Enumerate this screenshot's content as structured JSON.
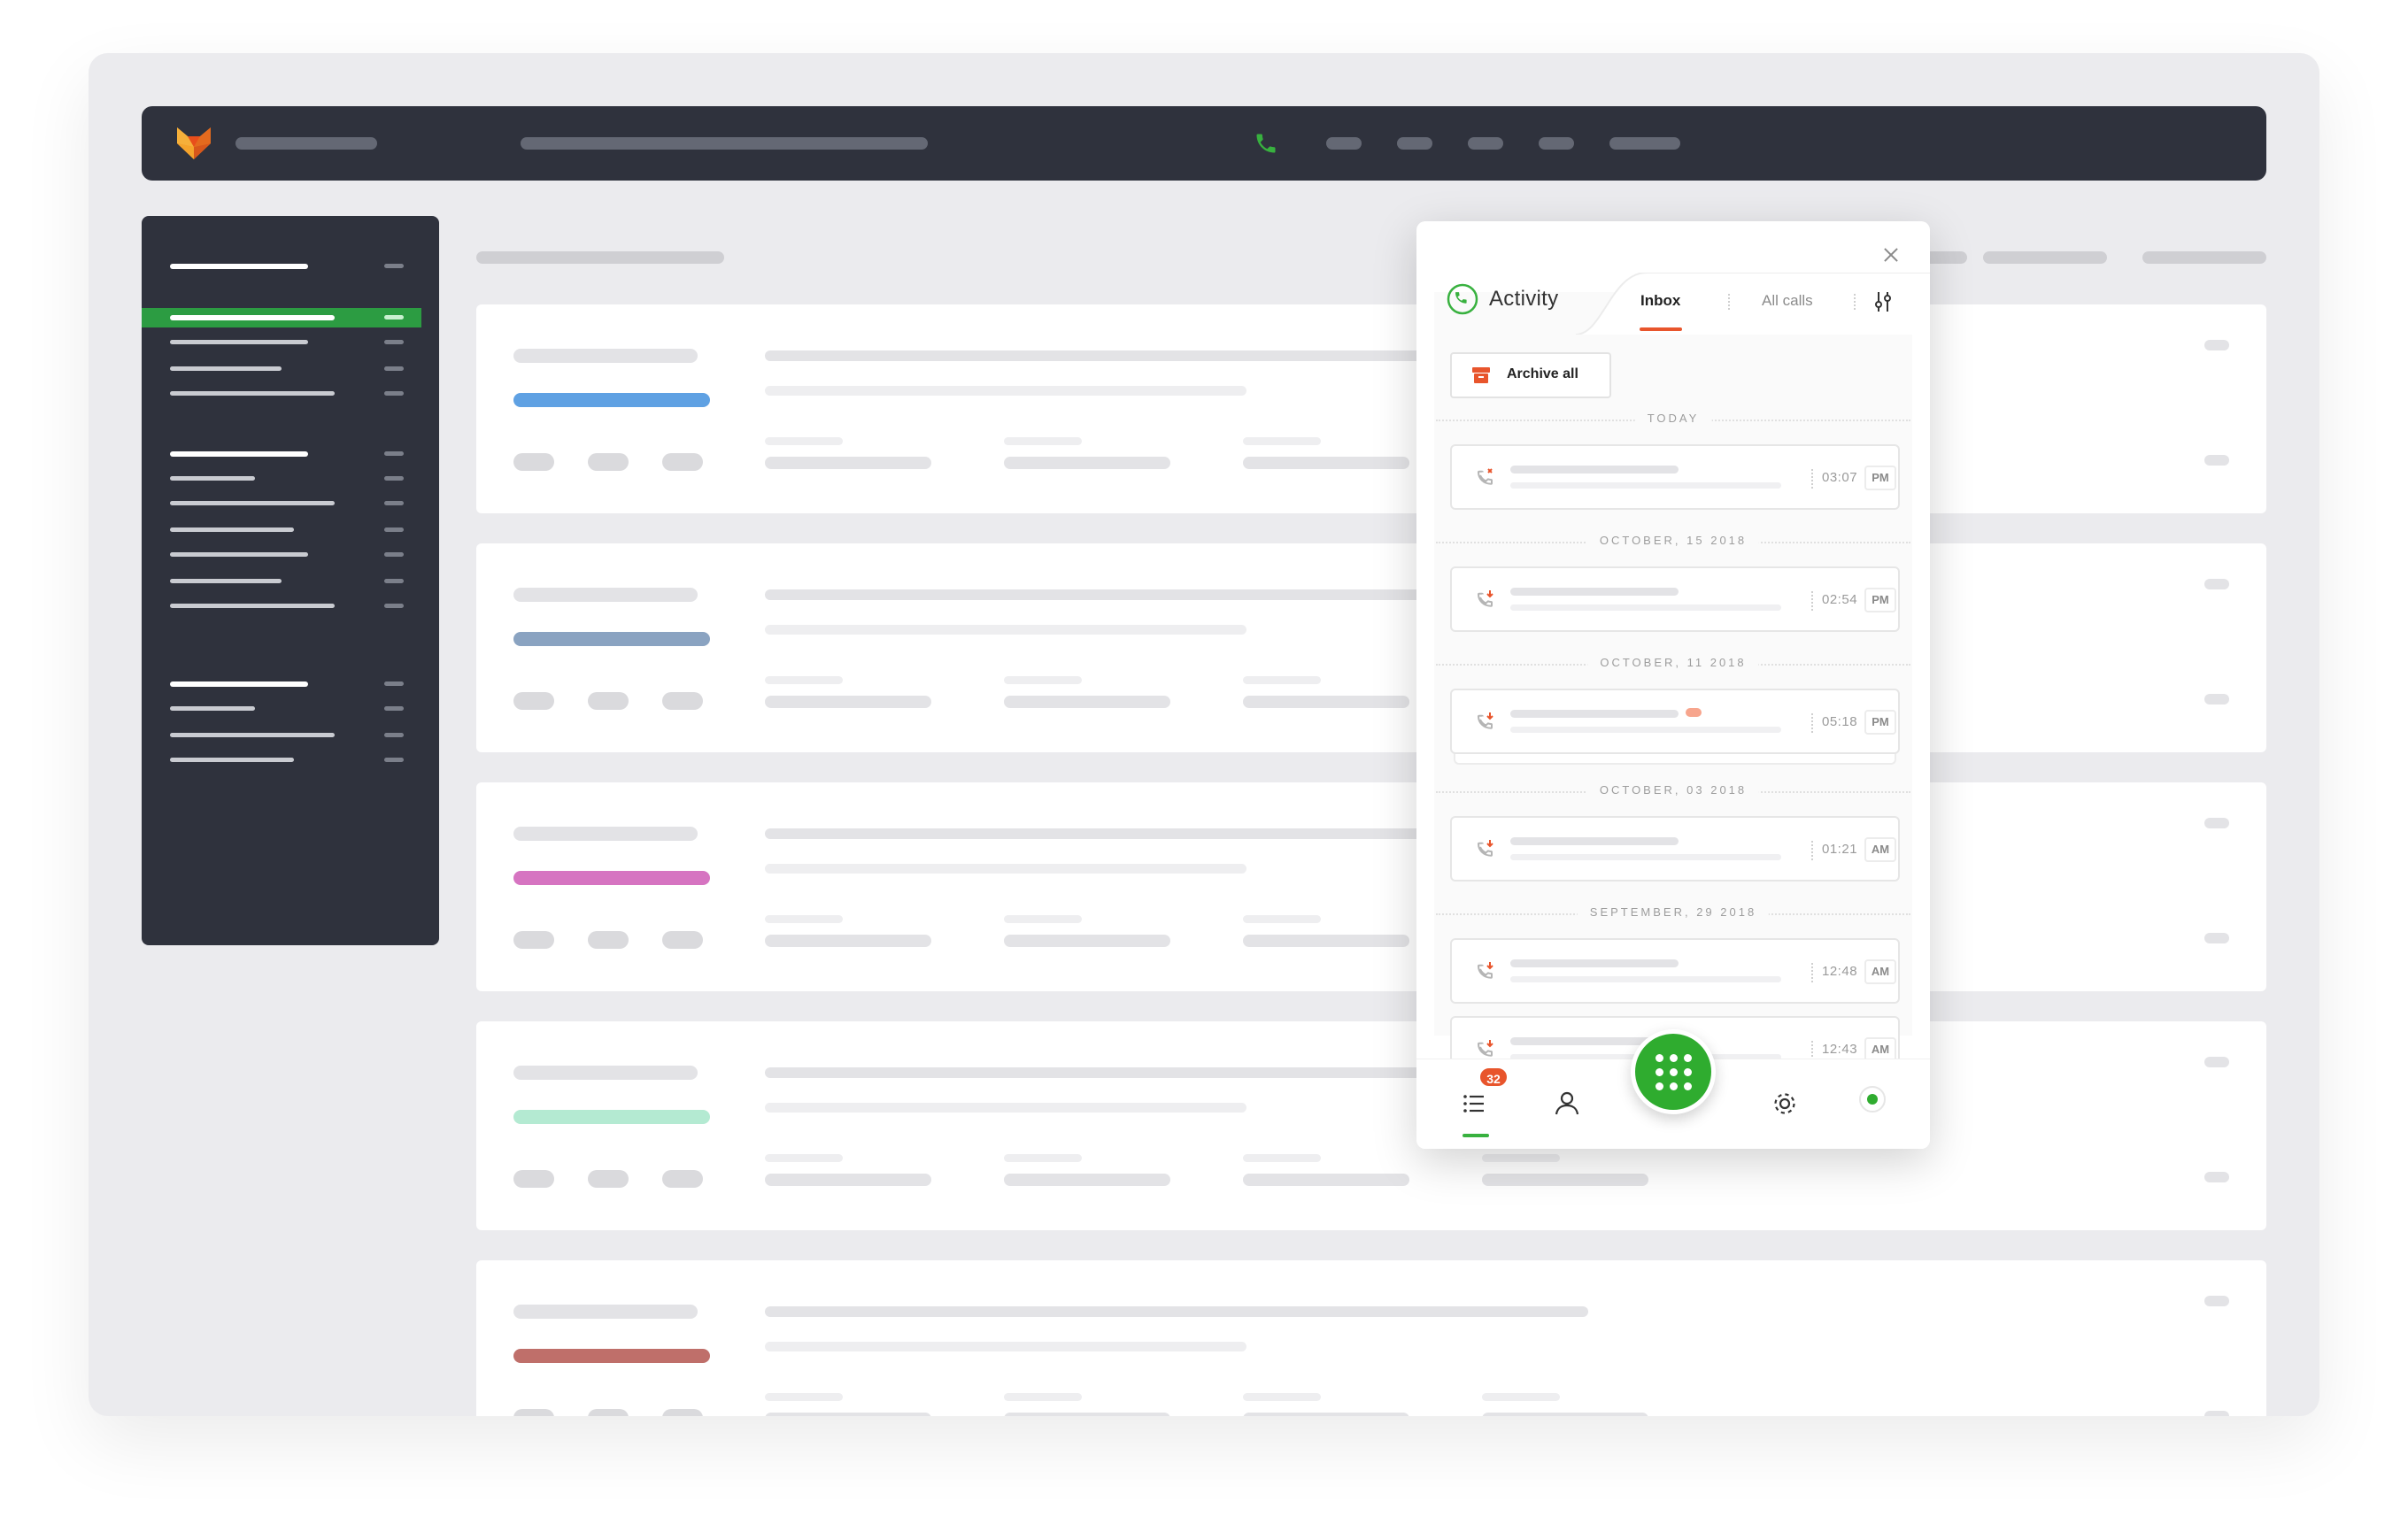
{
  "colors": {
    "accent_green": "#2fac2f",
    "accent_orange": "#e8552c",
    "sidebar_active": "#2c9c42",
    "card_bar_colors": [
      "#5fa1e3",
      "#8aa3c1",
      "#d674c1",
      "#b4ead2",
      "#bf6f6a"
    ]
  },
  "popup": {
    "title": "Activity",
    "tabs": [
      "Inbox",
      "All calls"
    ],
    "active_tab": "Inbox",
    "archive_label": "Archive all",
    "groups": [
      {
        "date": "TODAY",
        "calls": [
          {
            "time": "03:07",
            "ampm": "PM",
            "type": "missed"
          }
        ]
      },
      {
        "date": "OCTOBER, 15 2018",
        "calls": [
          {
            "time": "02:54",
            "ampm": "PM",
            "type": "incoming"
          }
        ]
      },
      {
        "date": "OCTOBER, 11 2018",
        "calls": [
          {
            "time": "05:18",
            "ampm": "PM",
            "type": "incoming",
            "stacked": true
          }
        ]
      },
      {
        "date": "OCTOBER, 03 2018",
        "calls": [
          {
            "time": "01:21",
            "ampm": "AM",
            "type": "incoming"
          }
        ]
      },
      {
        "date": "SEPTEMBER, 29 2018",
        "calls": [
          {
            "time": "12:48",
            "ampm": "AM",
            "type": "incoming"
          },
          {
            "time": "12:43",
            "ampm": "AM",
            "type": "incoming"
          }
        ]
      }
    ],
    "nav": {
      "activity_badge": "32",
      "status": "online"
    }
  },
  "icons": {
    "app": "fox-logo-icon",
    "call": "phone-icon",
    "filter": "sliders-icon",
    "archive": "archive-box-icon",
    "missed": "missed-call-icon",
    "incoming": "incoming-call-icon",
    "list": "list-icon",
    "contacts": "user-icon",
    "dialpad": "dialpad-icon",
    "settings": "gear-icon"
  }
}
